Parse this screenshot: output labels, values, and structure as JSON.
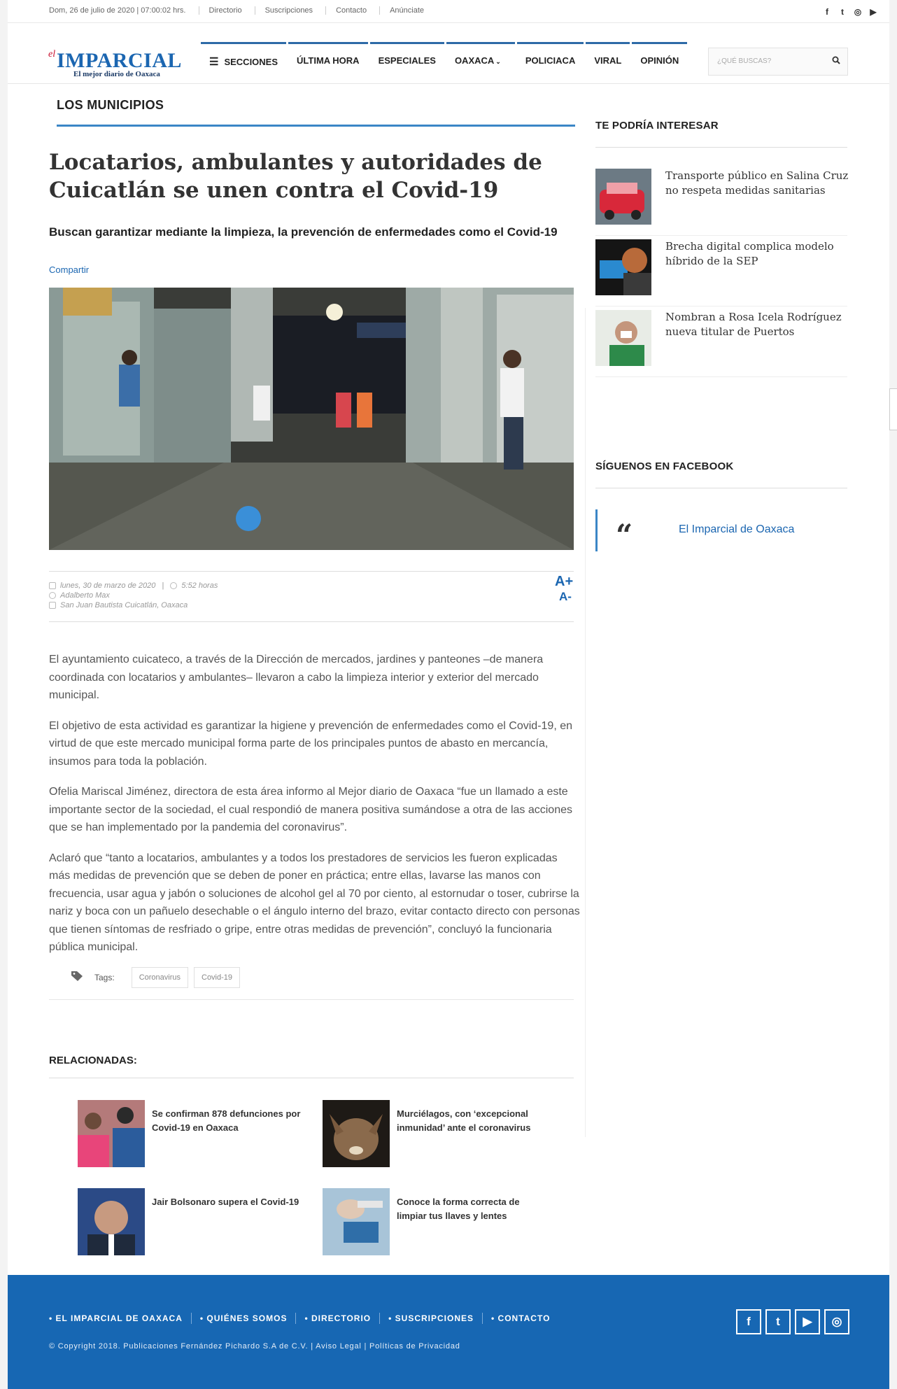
{
  "topbar": {
    "date": "Dom, 26 de julio de 2020 | 07:00:02 hrs.",
    "links": [
      "Directorio",
      "Suscripciones",
      "Contacto",
      "Anúnciate"
    ],
    "social": [
      {
        "icon": "facebook-icon",
        "glyph": "f"
      },
      {
        "icon": "twitter-icon",
        "glyph": "t"
      },
      {
        "icon": "instagram-icon",
        "glyph": "◎"
      },
      {
        "icon": "youtube-icon",
        "glyph": "▶"
      }
    ]
  },
  "header": {
    "logo": {
      "prefix": "el",
      "name": "IMPARCIAL",
      "tagline": "El mejor diario de Oaxaca"
    },
    "nav": {
      "sections": "SECCIONES",
      "items": [
        "ÚLTIMA HORA",
        "ESPECIALES",
        "OAXACA",
        "POLICIACA",
        "VIRAL",
        "OPINIÓN"
      ]
    },
    "search_placeholder": "¿QUÉ BUSCAS?"
  },
  "article": {
    "section": "LOS MUNICIPIOS",
    "headline": "Locatarios, ambulantes y autoridades de Cuicatlán se unen contra el Covid-19",
    "subhead": "Buscan garantizar mediante la limpieza, la prevención de enfermedades como el Covid-19",
    "share": "Compartir",
    "date": "lunes, 30 de marzo de 2020",
    "time": "5:52 horas",
    "author": "Adalberto Max",
    "location": "San Juan Bautista Cuicatlán, Oaxaca",
    "font_up": "A+",
    "font_down": "A-",
    "paragraphs": [
      "El ayuntamiento cuicateco, a través de la Dirección de mercados, jardines y panteones –de manera coordinada con locatarios y ambulantes– llevaron a cabo la limpieza interior y exterior del mercado municipal.",
      "El objetivo de esta actividad es garantizar la higiene y prevención de enfermedades como el Covid-19, en virtud de que este mercado municipal forma parte de los principales puntos de abasto en mercancía, insumos para toda la población.",
      "Ofelia Mariscal Jiménez, directora de esta área informo al Mejor diario de Oaxaca “fue un llamado a este importante sector de la sociedad, el cual respondió de manera positiva sumándose a otra de las acciones que se han implementado por la pandemia del coronavirus”.",
      "Aclaró que “tanto a locatarios, ambulantes y a todos los prestadores de servicios les fueron explicadas más medidas de prevención que se deben de poner en práctica; entre ellas, lavarse las manos con frecuencia, usar agua y jabón o soluciones de alcohol gel al 70 por ciento, al estornudar o toser, cubrirse la nariz y boca con un pañuelo desechable o el ángulo interno del brazo, evitar contacto directo con personas que tienen síntomas de resfriado o gripe, entre otras medidas de prevención”, concluyó la funcionaria pública municipal."
    ],
    "tags_label": "Tags:",
    "tags": [
      "Coronavirus",
      "Covid-19"
    ]
  },
  "related": {
    "title": "RELACIONADAS:",
    "items": [
      "Se confirman 878 defunciones por Covid-19 en Oaxaca",
      "Murciélagos, con ‘excepcional inmunidad’ ante el coronavirus",
      "Jair Bolsonaro supera el Covid-19",
      "Conoce la forma correcta de limpiar tus llaves y lentes"
    ]
  },
  "sidebar": {
    "interest_title": "TE PODRÍA INTERESAR",
    "items": [
      "Transporte público en Salina Cruz no respeta medidas sanitarias",
      "Brecha digital complica modelo híbrido de la SEP",
      "Nombran a Rosa Icela Rodríguez nueva titular de Puertos"
    ],
    "facebook_title": "SÍGUENOS EN FACEBOOK",
    "facebook_quote": "“",
    "facebook_name": "El Imparcial de Oaxaca"
  },
  "footer": {
    "links": [
      "• EL IMPARCIAL DE OAXACA",
      "• QUIÉNES SOMOS",
      "• DIRECTORIO",
      "• SUSCRIPCIONES",
      "• CONTACTO"
    ],
    "copyright": "© Copyright 2018. Publicaciones Fernández Pichardo S.A de C.V. | Aviso Legal | Políticas de Privacidad",
    "social": [
      {
        "icon": "facebook-icon",
        "glyph": "f"
      },
      {
        "icon": "twitter-icon",
        "glyph": "t"
      },
      {
        "icon": "youtube-icon",
        "glyph": "▶"
      },
      {
        "icon": "instagram-icon",
        "glyph": "◎"
      }
    ]
  },
  "colors": {
    "brand_blue": "#1767b3",
    "accent_line": "#3b86c6",
    "logo_red": "#c8102e"
  }
}
